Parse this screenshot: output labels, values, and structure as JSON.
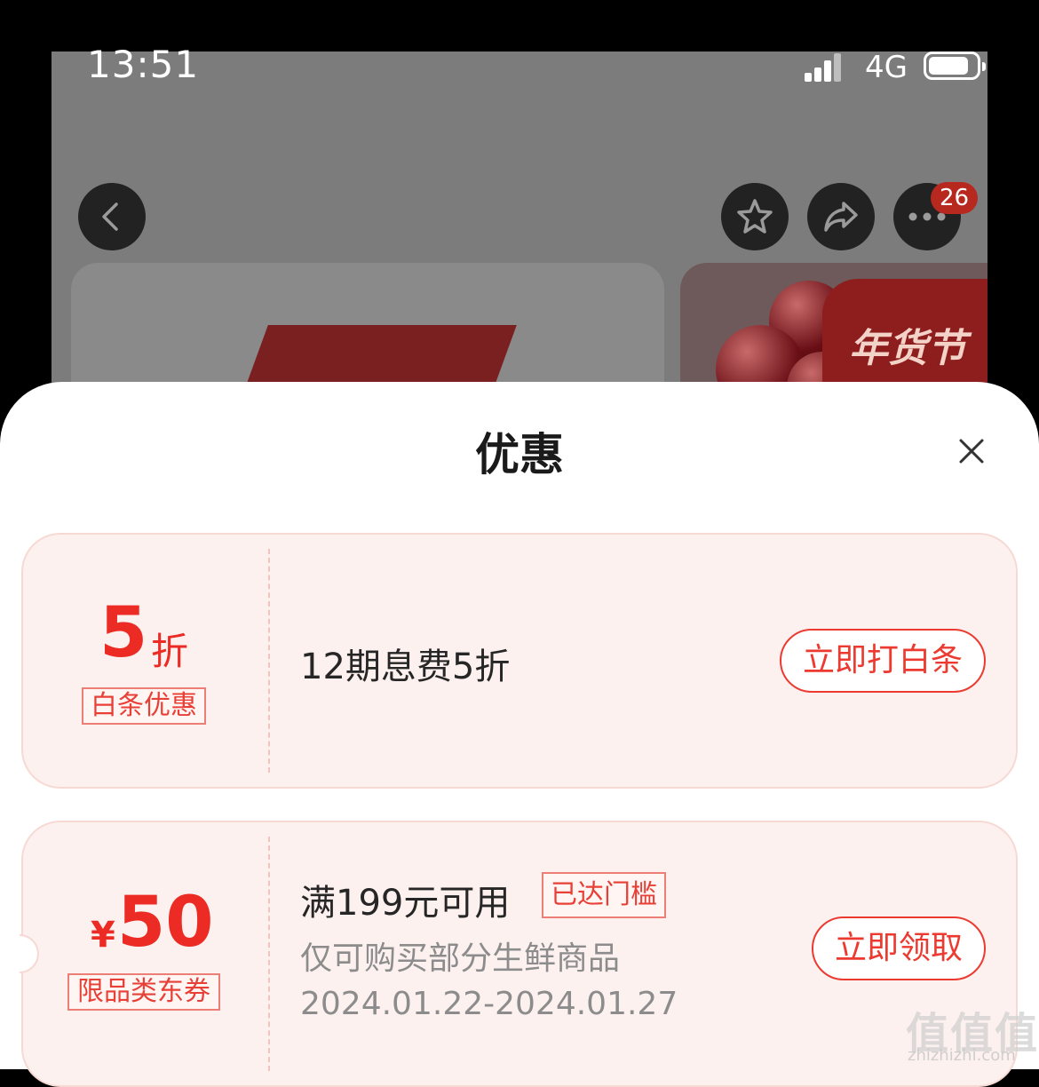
{
  "status_bar": {
    "time": "13:51",
    "network": "4G"
  },
  "top_bar": {
    "more_badge": "26"
  },
  "banner": {
    "promo_text": "年货节"
  },
  "sheet": {
    "title": "优惠",
    "cards": [
      {
        "amount": "5",
        "amount_unit": "折",
        "tag": "白条优惠",
        "title": "12期息费5折",
        "button": "立即打白条"
      },
      {
        "currency": "¥",
        "amount": "50",
        "tag": "限品类东券",
        "title": "满199元可用",
        "status_tag": "已达门槛",
        "description": "仅可购买部分生鲜商品",
        "validity": "2024.01.22-2024.01.27",
        "button": "立即领取"
      }
    ]
  },
  "watermark": {
    "text": "值值值",
    "url": "zhizhizhi.com"
  },
  "colors": {
    "accent": "#ec2b25",
    "card_bg": "#fdf1ef",
    "overlay": "#7c7c7c"
  },
  "icons": [
    "back-icon",
    "star-icon",
    "share-icon",
    "more-icon",
    "close-icon"
  ]
}
